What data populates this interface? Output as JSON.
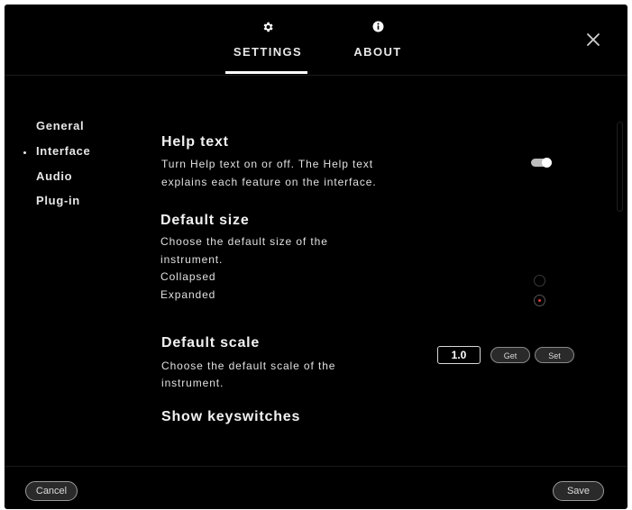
{
  "header": {
    "tabs": [
      {
        "label": "SETTINGS",
        "icon": "gear-icon",
        "active": true
      },
      {
        "label": "ABOUT",
        "icon": "info-icon",
        "active": false
      }
    ],
    "close_icon": "close-icon"
  },
  "sidebar": {
    "items": [
      {
        "label": "General",
        "active": false
      },
      {
        "label": "Interface",
        "active": true
      },
      {
        "label": "Audio",
        "active": false
      },
      {
        "label": "Plug-in",
        "active": false
      }
    ]
  },
  "help_text": {
    "title": "Help text",
    "description_lines": [
      "Turn Help text on or off. The Help text",
      "explains each feature on the interface."
    ],
    "enabled": true
  },
  "default_size": {
    "title": "Default size",
    "description_lines": [
      "Choose the default size of the",
      "instrument."
    ],
    "options": [
      "Collapsed",
      "Expanded"
    ],
    "selected": "Expanded"
  },
  "default_scale": {
    "title": "Default scale",
    "description_lines": [
      "Choose the default scale of the",
      "instrument."
    ],
    "value": "1.0",
    "get_label": "Get",
    "set_label": "Set"
  },
  "show_keyswitches": {
    "title": "Show keyswitches"
  },
  "footer": {
    "cancel_label": "Cancel",
    "save_label": "Save"
  },
  "colors": {
    "background": "#000000",
    "text": "#ffffff",
    "radio_selected": "#e33a3a",
    "toggle_on": "#bdbdbd"
  }
}
